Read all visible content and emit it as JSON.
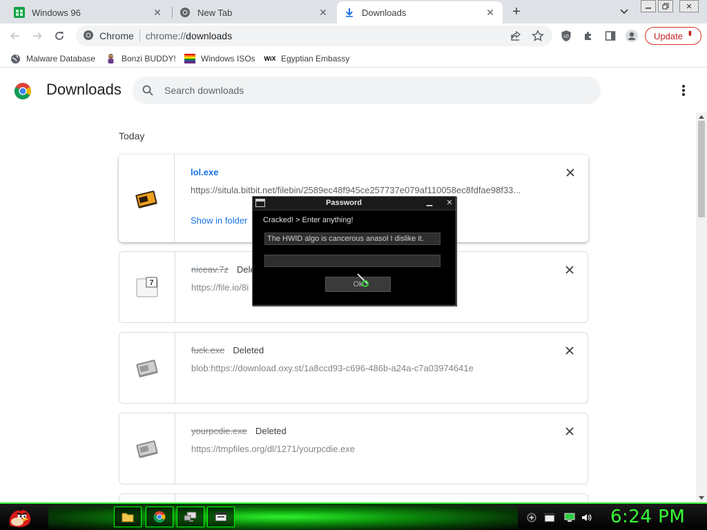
{
  "tabs": [
    {
      "title": "Windows 96",
      "icon": "win96-icon"
    },
    {
      "title": "New Tab",
      "icon": "chrome-icon"
    },
    {
      "title": "Downloads",
      "icon": "download-icon",
      "active": true
    }
  ],
  "address": {
    "scheme_label": "Chrome",
    "url_prefix": "chrome://",
    "url_path": "downloads"
  },
  "update_label": "Update",
  "bookmarks": [
    {
      "label": "Malware Database",
      "icon": "globe-icon"
    },
    {
      "label": "Bonzi BUDDY!",
      "icon": "bonzi-icon"
    },
    {
      "label": "Windows ISOs",
      "icon": "rainbow-flag-icon"
    },
    {
      "label": "Egyptian Embassy",
      "icon": "wix-icon"
    }
  ],
  "page": {
    "title": "Downloads",
    "search_placeholder": "Search downloads",
    "section_today": "Today"
  },
  "downloads": [
    {
      "name": "lol.exe",
      "status": "",
      "url": "https://situla.bitbit.net/filebin/2589ec48f945ce257737e079af110058ec8fdfae98f33...",
      "action": "Show in folder",
      "deleted": false
    },
    {
      "name": "niceav.7z",
      "status": "Dele",
      "url": "https://file.io/8i",
      "deleted": true
    },
    {
      "name": "fuck.exe",
      "status": "Deleted",
      "url": "blob:https://download.oxy.st/1a8ccd93-c696-486b-a24a-c7a03974641e",
      "deleted": true
    },
    {
      "name": "yourpcdie.exe",
      "status": "Deleted",
      "url": "https://tmpfiles.org/dl/1271/yourpcdie.exe",
      "deleted": true
    }
  ],
  "dialog": {
    "title": "Password",
    "prompt": "Cracked! > Enter anything!",
    "input1_value": "The HWID algo is cancerous anasol I dislike it.",
    "input2_value": "",
    "ok_label": "Ok"
  },
  "taskbar": {
    "clock": "6:24 PM"
  },
  "colors": {
    "accent_link": "#1a73e8",
    "update_red": "#d93025",
    "taskbar_green": "#36ff36"
  }
}
